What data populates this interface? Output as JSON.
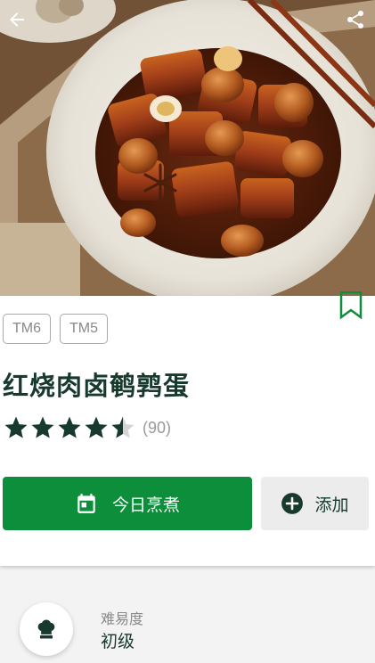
{
  "header": {
    "back_icon": "arrow-left-icon",
    "share_icon": "share-icon",
    "image_subject": "braised pork with quail eggs in white bowl"
  },
  "recipe": {
    "devices": [
      "TM6",
      "TM5"
    ],
    "title": "红烧肉卤鹌鹑蛋",
    "rating_value": 4.5,
    "rating_max": 5,
    "rating_count": "(90)",
    "bookmark_icon": "bookmark-outline-icon"
  },
  "actions": {
    "cook_today_label": "今日烹煮",
    "cook_today_icon": "calendar-icon",
    "add_label": "添加",
    "add_icon": "plus-circle-icon"
  },
  "info": {
    "difficulty_label": "难易度",
    "difficulty_value": "初级",
    "difficulty_icon": "chef-hat-icon"
  },
  "colors": {
    "primary_green": "#0c8e3a",
    "dark_green": "#173a2c"
  }
}
